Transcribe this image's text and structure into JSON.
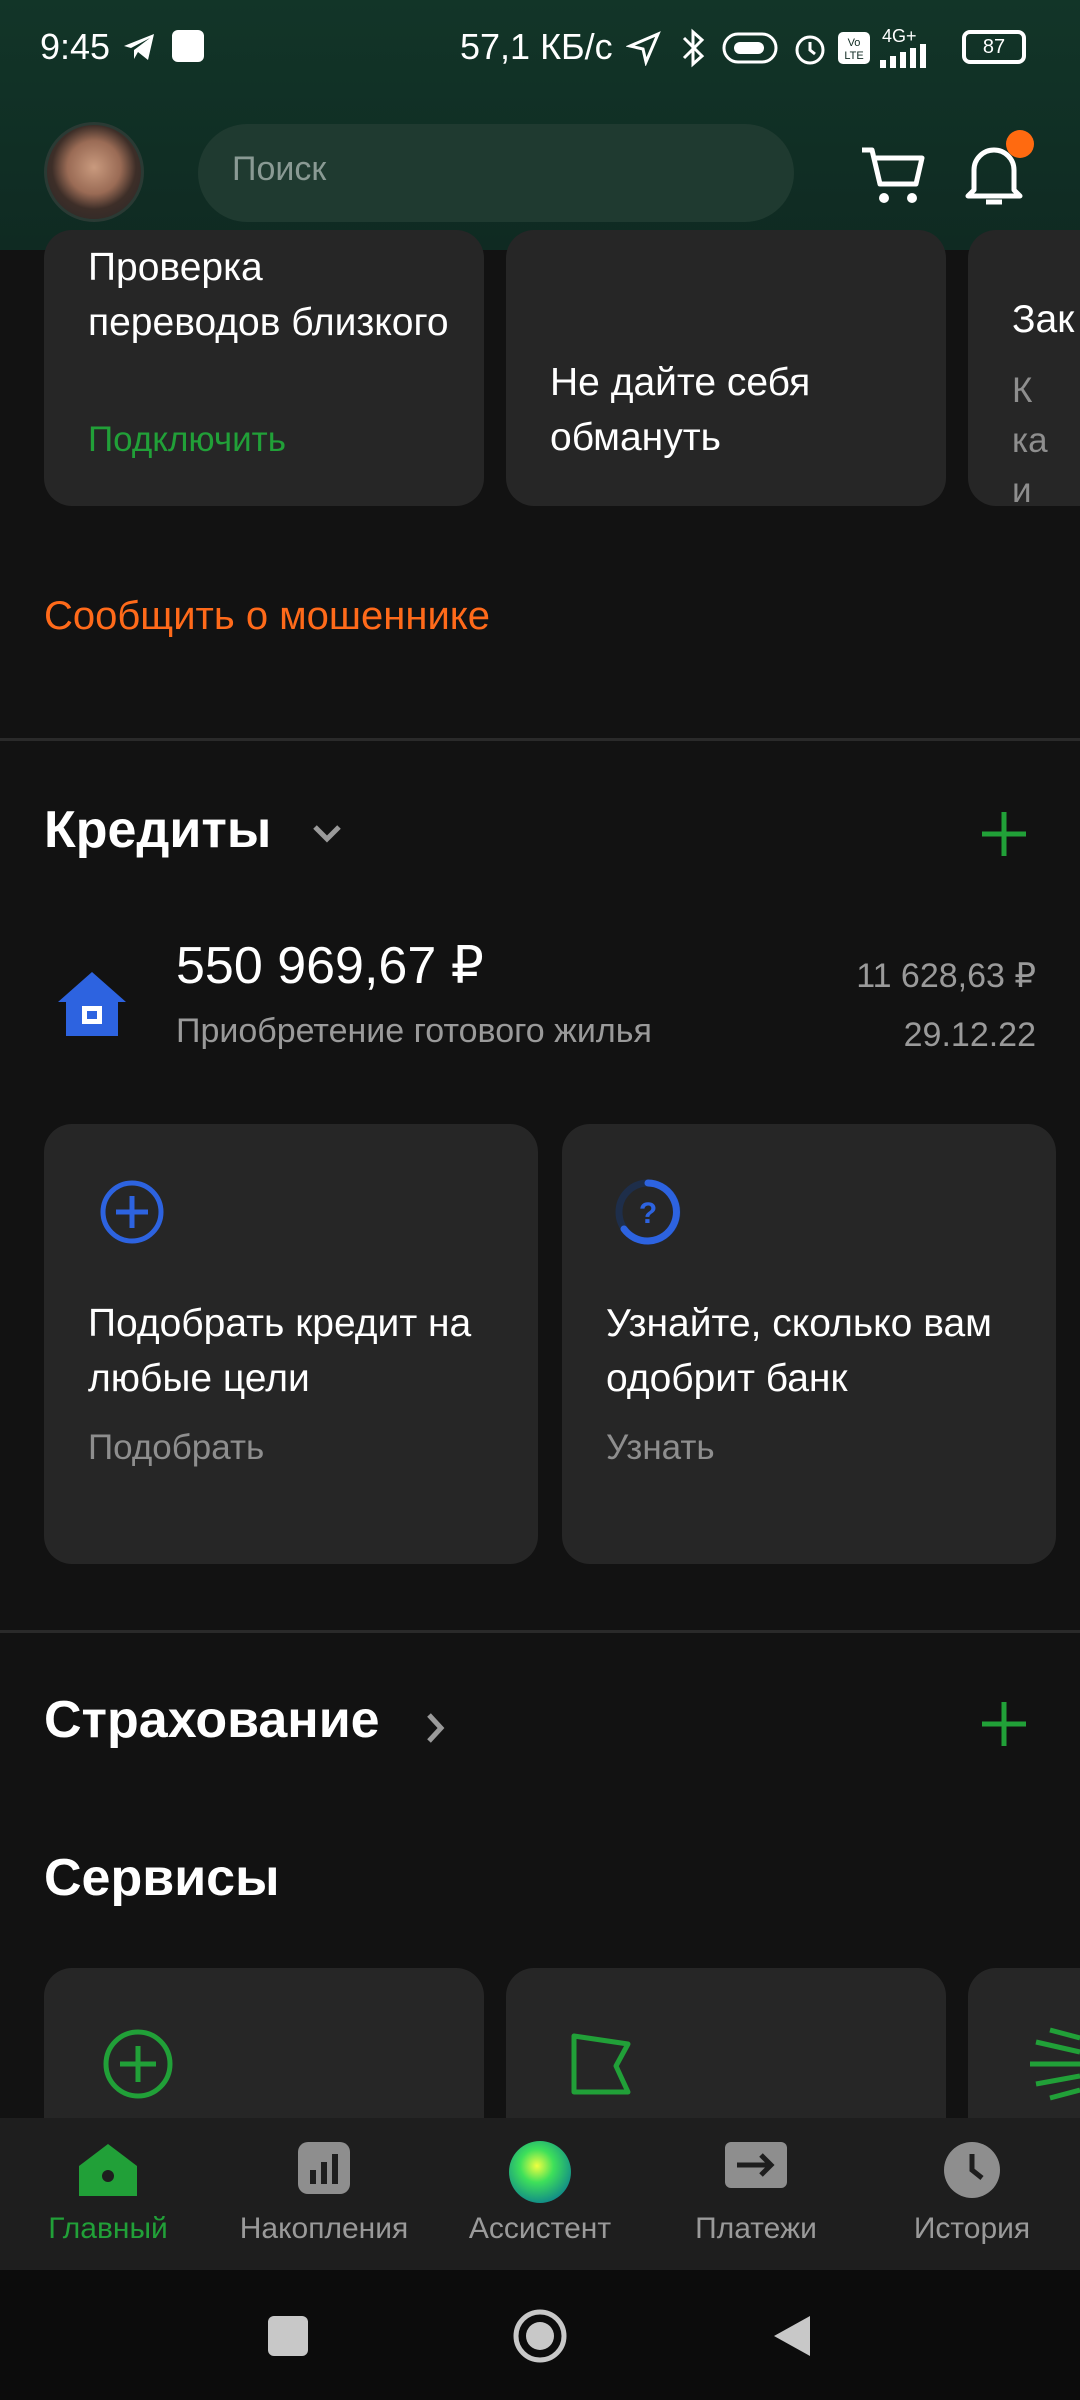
{
  "status": {
    "time": "9:45",
    "speed": "57,1 КБ/с",
    "network": "4G+",
    "battery": "87"
  },
  "header": {
    "search_placeholder": "Поиск"
  },
  "promo_cards": [
    {
      "title": "Проверка переводов близкого",
      "action": "Подключить"
    },
    {
      "title": "Не дайте себя обмануть"
    },
    {
      "title": "Зак",
      "subtitle": "К ка и сч"
    }
  ],
  "report_link": "Сообщить о мошеннике",
  "credits": {
    "title": "Кредиты",
    "loan": {
      "amount": "550 969,67 ₽",
      "name": "Приобретение готового жилья",
      "payment": "11 628,63 ₽",
      "date": "29.12.22"
    },
    "offers": [
      {
        "title": "Подобрать кредит на любые цели",
        "action": "Подобрать"
      },
      {
        "title": "Узнайте, сколько вам одобрит банк",
        "action": "Узнать"
      }
    ]
  },
  "insurance": {
    "title": "Страхование"
  },
  "services": {
    "title": "Сервисы"
  },
  "bottom_nav": [
    {
      "label": "Главный",
      "active": true
    },
    {
      "label": "Накопления"
    },
    {
      "label": "Ассистент"
    },
    {
      "label": "Платежи"
    },
    {
      "label": "История"
    }
  ],
  "colors": {
    "accent": "#21a038",
    "warning": "#ff6a1a",
    "blue": "#2d63e0"
  }
}
